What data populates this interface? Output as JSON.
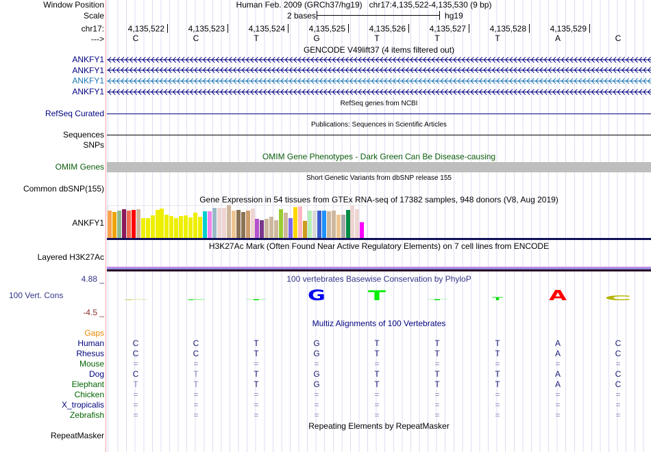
{
  "header": {
    "window_position_label": "Window Position",
    "title": "Human Feb. 2009 (GRCh37/hg19)   chr17:4,135,522-4,135,530 (9 bp)",
    "scale_label": "Scale",
    "scale_text": "2 bases",
    "assembly": "hg19",
    "chrom_label": "chr17:",
    "strand_label": "--->",
    "positions": [
      "4,135,522",
      "4,135,523",
      "4,135,524",
      "4,135,525",
      "4,135,526",
      "4,135,527",
      "4,135,528",
      "4,135,529"
    ],
    "bases": [
      "C",
      "C",
      "T",
      "G",
      "T",
      "T",
      "T",
      "A",
      "C"
    ]
  },
  "tracks": {
    "gencode": {
      "title": "GENCODE V49lift37 (4 items filtered out)",
      "items": [
        {
          "label": "ANKFY1",
          "color": "#000080"
        },
        {
          "label": "ANKFY1",
          "color": "#000080"
        },
        {
          "label": "ANKFY1",
          "color": "#1a74b4"
        },
        {
          "label": "ANKFY1",
          "color": "#000080"
        }
      ]
    },
    "refseq": {
      "title": "RefSeq genes from NCBI",
      "label": "RefSeq Curated",
      "color": "#000080"
    },
    "publications": {
      "title": "Publications: Sequences in Scientific Articles",
      "label": "Sequences"
    },
    "snps": {
      "label": "SNPs"
    },
    "omim": {
      "title": "OMIM Gene Phenotypes - Dark Green Can Be Disease-causing",
      "label": "OMIM Genes",
      "color": "#0a5c0a",
      "bar_color": "#bebebe"
    },
    "dbsnp": {
      "title": "Short Genetic Variants from dbSNP release 155",
      "label": "Common dbSNP(155)"
    },
    "gtex": {
      "title": "Gene Expression in 54 tissues from GTEx RNA-seq of 17382 samples, 948 donors (V8, Aug 2019)",
      "label": "ANKFY1",
      "relative_levels": [
        40,
        38,
        40,
        42,
        40,
        41,
        42,
        29,
        29,
        33,
        41,
        43,
        34,
        32,
        29,
        32,
        33,
        30,
        37,
        31,
        39,
        39,
        44,
        44,
        44,
        48,
        40,
        41,
        38,
        40,
        43,
        28,
        26,
        28,
        31,
        26,
        42,
        37,
        29,
        45,
        46,
        25,
        40,
        40,
        40,
        40,
        39,
        40,
        34,
        34,
        41,
        47,
        42,
        23
      ],
      "colors": [
        "#f9a24f",
        "#f0a30a",
        "#8fbc8f",
        "#8b1a5b",
        "#ee6a50",
        "#ff0000",
        "#cdb79e",
        "#eeee00",
        "#eeee00",
        "#eeee00",
        "#eeee00",
        "#eeee00",
        "#eeee00",
        "#eeee00",
        "#eeee00",
        "#eeee00",
        "#eeee00",
        "#eeee00",
        "#eeee00",
        "#eeee00",
        "#00ced1",
        "#ee82ee",
        "#9ab9c9",
        "#eed5d2",
        "#eed5d2",
        "#cdb79e",
        "#eec591",
        "#8b7355",
        "#8b7355",
        "#cd9b6b",
        "#eed5d2",
        "#b452cd",
        "#7a378b",
        "#cdb79e",
        "#cdb79e",
        "#cdb79e",
        "#9acd32",
        "#cdb79e",
        "#7b68ee",
        "#ffd700",
        "#ffb6c1",
        "#cd9b1d",
        "#b4eeb4",
        "#d9d9d9",
        "#3a5fcd",
        "#1e90ff",
        "#cdb79e",
        "#cdb79e",
        "#eec591",
        "#a6a6a6",
        "#008b45",
        "#eed5d2",
        "#eed5d2",
        "#ff00ff"
      ]
    },
    "h3k27ac": {
      "title": "H3K27Ac Mark (Often Found Near Active Regulatory Elements) on 7 cell lines from ENCODE",
      "label": "Layered H3K27Ac"
    },
    "phylop": {
      "title": "100 vertebrates Basewise Conservation by PhyloP",
      "label": "100 Vert. Cons",
      "max_label": "4.88 _",
      "min_label": "-4.5 _",
      "logo": [
        {
          "base": "C",
          "color": "#c8c864",
          "level": 0.05
        },
        {
          "base": "C",
          "color": "#00dd00",
          "level": 0.03
        },
        {
          "base": "T",
          "color": "#00dd00",
          "level": 0.08
        },
        {
          "base": "G",
          "color": "#0000ee",
          "level": 1.0
        },
        {
          "base": "T",
          "color": "#00ee00",
          "level": 0.9
        },
        {
          "base": "T",
          "color": "#00dd00",
          "level": 0.08
        },
        {
          "base": "T",
          "color": "#00dd00",
          "level": 0.3
        },
        {
          "base": "A",
          "color": "#ff0000",
          "level": 0.95
        },
        {
          "base": "C",
          "color": "#b4b400",
          "level": 0.45
        }
      ]
    },
    "multiz": {
      "title": "Multiz Alignments of 100 Vertebrates",
      "gaps_label": "Gaps",
      "species": [
        {
          "name": "Human",
          "color": "#000080",
          "seq": [
            "C",
            "C",
            "T",
            "G",
            "T",
            "T",
            "T",
            "A",
            "C"
          ]
        },
        {
          "name": "Rhesus",
          "color": "#000080",
          "seq": [
            "C",
            "C",
            "T",
            "G",
            "T",
            "T",
            "T",
            "A",
            "C"
          ]
        },
        {
          "name": "Mouse",
          "color": "#006400",
          "seq": [
            "=",
            "=",
            "=",
            "=",
            "=",
            "=",
            "=",
            "=",
            "="
          ]
        },
        {
          "name": "Dog",
          "color": "#000080",
          "seq": [
            "C",
            "T",
            "T",
            "G",
            "T",
            "T",
            "T",
            "A",
            "C"
          ]
        },
        {
          "name": "Elephant",
          "color": "#006400",
          "seq": [
            "T",
            "T",
            "T",
            "G",
            "T",
            "T",
            "T",
            "A",
            "C"
          ]
        },
        {
          "name": "Chicken",
          "color": "#006400",
          "seq": [
            "=",
            "=",
            "=",
            "=",
            "=",
            "=",
            "=",
            "=",
            "="
          ]
        },
        {
          "name": "X_tropicalis",
          "color": "#000080",
          "seq": [
            "=",
            "=",
            "=",
            "=",
            "=",
            "=",
            "=",
            "=",
            "="
          ]
        },
        {
          "name": "Zebrafish",
          "color": "#006400",
          "seq": [
            "=",
            "=",
            "=",
            "=",
            "=",
            "=",
            "=",
            "=",
            "="
          ]
        }
      ]
    },
    "repeatmasker": {
      "title": "Repeating Elements by RepeatMasker",
      "label": "RepeatMasker"
    }
  }
}
